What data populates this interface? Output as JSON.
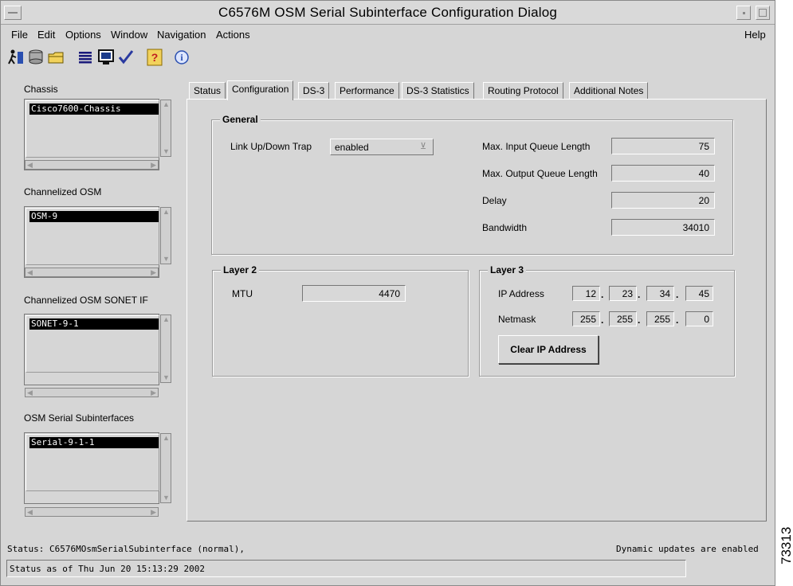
{
  "window": {
    "title": "C6576M OSM Serial Subinterface Configuration Dialog"
  },
  "menu": {
    "items": [
      {
        "label": "File"
      },
      {
        "label": "Edit"
      },
      {
        "label": "Options"
      },
      {
        "label": "Window"
      },
      {
        "label": "Navigation"
      },
      {
        "label": "Actions"
      }
    ],
    "help": "Help"
  },
  "toolbar": {
    "icons": [
      "run-icon",
      "database-icon",
      "folder-icon",
      "list-icon",
      "monitor-icon",
      "checkmark-icon",
      "help-question-icon",
      "info-icon"
    ]
  },
  "left_panel": {
    "lists": [
      {
        "label": "Chassis",
        "selected": "Cisco7600-Chassis"
      },
      {
        "label": "Channelized OSM",
        "selected": "OSM-9"
      },
      {
        "label": "Channelized OSM SONET IF",
        "selected": "SONET-9-1"
      },
      {
        "label": "OSM Serial Subinterfaces",
        "selected": "Serial-9-1-1"
      }
    ]
  },
  "tabs": [
    {
      "label": "Status"
    },
    {
      "label": "Configuration"
    },
    {
      "label": "DS-3"
    },
    {
      "label": "Performance"
    },
    {
      "label": "DS-3 Statistics"
    },
    {
      "label": "Routing Protocol"
    },
    {
      "label": "Additional Notes"
    }
  ],
  "active_tab": "Configuration",
  "general": {
    "title": "General",
    "link_trap_label": "Link Up/Down Trap",
    "link_trap_value": "enabled",
    "max_input_label": "Max. Input Queue Length",
    "max_input_value": "75",
    "max_output_label": "Max. Output Queue Length",
    "max_output_value": "40",
    "delay_label": "Delay",
    "delay_value": "20",
    "bandwidth_label": "Bandwidth",
    "bandwidth_value": "34010"
  },
  "layer2": {
    "title": "Layer 2",
    "mtu_label": "MTU",
    "mtu_value": "4470"
  },
  "layer3": {
    "title": "Layer 3",
    "ip_label": "IP Address",
    "ip": [
      "12",
      "23",
      "34",
      "45"
    ],
    "netmask_label": "Netmask",
    "netmask": [
      "255",
      "255",
      "255",
      "0"
    ],
    "clear_button": "Clear IP Address"
  },
  "status": {
    "line": "Status: C6576MOsmSerialSubinterface (normal),",
    "dynamic": "Dynamic updates are enabled",
    "bar": "Status as of Thu Jun 20 15:13:29 2002"
  },
  "figure_id": "73313"
}
